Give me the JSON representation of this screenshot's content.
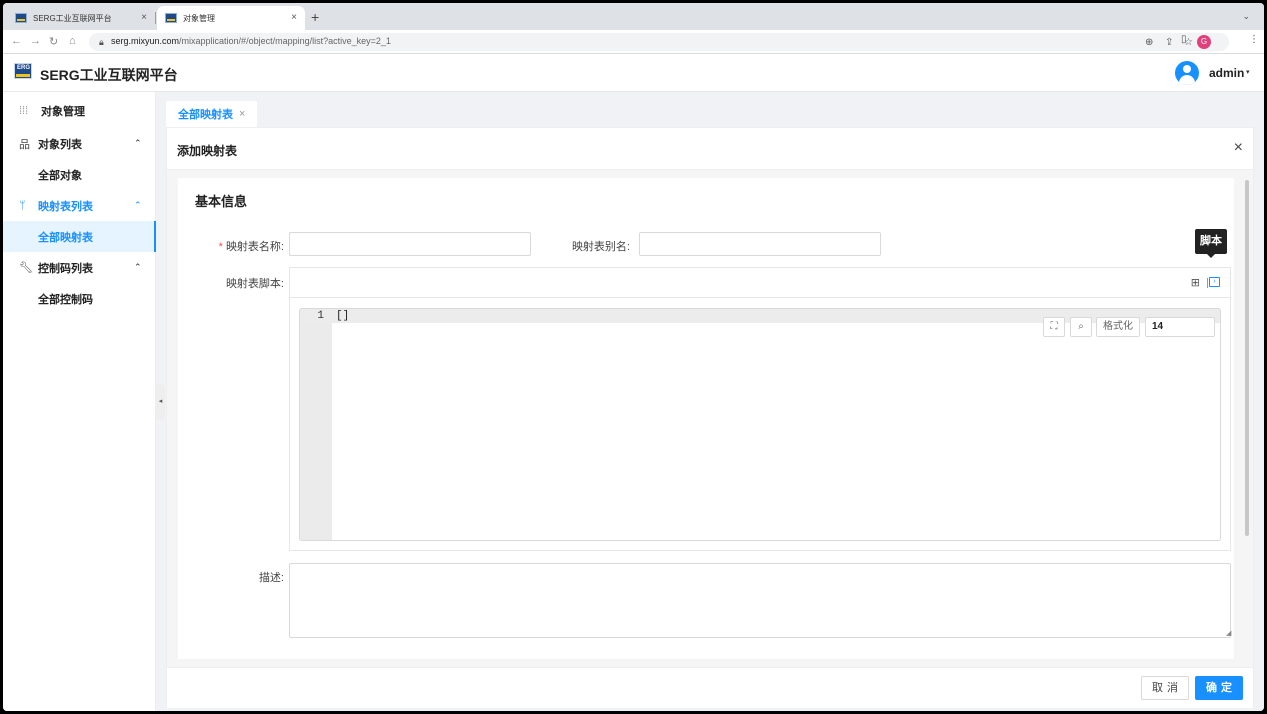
{
  "browser": {
    "tabs": [
      {
        "title": "SERG工业互联网平台",
        "close": "×"
      },
      {
        "title": "对象管理",
        "close": "×"
      }
    ],
    "new_tab": "+",
    "tab_menu": "⌄",
    "url_host": "serg.mixyun.com",
    "url_path": "/mixapplication/#/object/mapping/list?active_key=2_1",
    "profile_initial": "G"
  },
  "header": {
    "logo_text": "ERG",
    "title": "SERG工业互联网平台",
    "username": "admin",
    "dropdown": "▾"
  },
  "sidebar": {
    "title": "对象管理",
    "groups": [
      {
        "label": "对象列表",
        "icon": "hierarchy-icon",
        "arrow": "⌃",
        "items": [
          {
            "label": "全部对象"
          }
        ]
      },
      {
        "label": "映射表列表",
        "icon": "branch-icon",
        "arrow": "⌃",
        "items": [
          {
            "label": "全部映射表"
          }
        ]
      },
      {
        "label": "控制码列表",
        "icon": "wrench-icon",
        "arrow": "⌃",
        "items": [
          {
            "label": "全部控制码"
          }
        ]
      }
    ],
    "collapse_arrow": "◂"
  },
  "page_tab": {
    "label": "全部映射表",
    "close": "×"
  },
  "dialog": {
    "title": "添加映射表",
    "close": "×",
    "section_title": "基本信息",
    "fields": {
      "name_label": "映射表名称:",
      "name_required": "*",
      "name_value": "",
      "alias_label": "映射表别名:",
      "alias_value": "",
      "script_label": "映射表脚本:",
      "desc_label": "描述:",
      "desc_value": ""
    },
    "script_toolbar": {
      "tooltip": "脚本"
    },
    "editor": {
      "line_number": "1",
      "code": "[]",
      "format_label": "格式化",
      "font_size": "14"
    },
    "buttons": {
      "cancel": "取消",
      "ok": "确定"
    }
  },
  "colors": {
    "accent": "#1890ff",
    "required": "#ff4d4f"
  }
}
